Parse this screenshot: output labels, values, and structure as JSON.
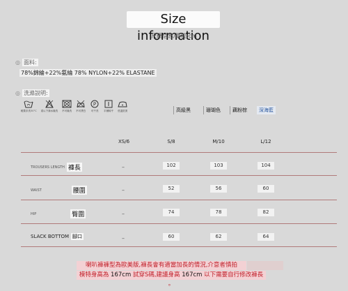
{
  "title": "Size information",
  "subtitle": "尺碼信息/單位:cm",
  "material": {
    "label": "面料:",
    "text": "78%錦綸+22%氨綸 78% NYLON+22% ELASTANE"
  },
  "washing": {
    "label": "洗滌說明:",
    "icons": [
      {
        "icon": "hand-wash-icon",
        "caption": "輕柔手洗30°C"
      },
      {
        "icon": "no-bleach-icon",
        "caption": "或以下清水機洗"
      },
      {
        "icon": "no-tumble-dry-icon",
        "caption": "不可機洗"
      },
      {
        "icon": "no-iron-icon",
        "caption": "不可漂白"
      },
      {
        "icon": "dry-clean-p-icon",
        "caption": "可干洗"
      },
      {
        "icon": "line-dry-icon",
        "caption": "平鋪晾干"
      },
      {
        "icon": "low-iron-icon",
        "caption": "低溫熨燙"
      }
    ]
  },
  "fabric_types": [
    "高級黑",
    "珊瑚色",
    "藕粉棕",
    "深海藍"
  ],
  "table": {
    "headers": [
      "XS/6",
      "S/8",
      "M/10",
      "L/12"
    ],
    "rows": [
      {
        "en": "TROUSERS LENGTH",
        "zh": "褲長",
        "values": [
          "–",
          "102",
          "103",
          "104"
        ]
      },
      {
        "en": "WAIST",
        "zh": "腰圍",
        "values": [
          "–",
          "52",
          "56",
          "60"
        ]
      },
      {
        "en": "HIP",
        "zh": "臀圍",
        "values": [
          "–",
          "74",
          "78",
          "82"
        ]
      },
      {
        "en": "SLACK BOTTOM",
        "zh": "腳口",
        "values": [
          "–",
          "60",
          "62",
          "64"
        ]
      }
    ]
  },
  "notes": {
    "line1": "喇叭褲褲型為歐美版,褲長會有適當加長的情況,介意者慎拍",
    "line2_a": "模特身高為",
    "line2_b": "167cm",
    "line2_c": "試穿S碼,建議身高",
    "line2_d": "167cm",
    "line2_e": "以下需要自行修改褲長 。"
  }
}
